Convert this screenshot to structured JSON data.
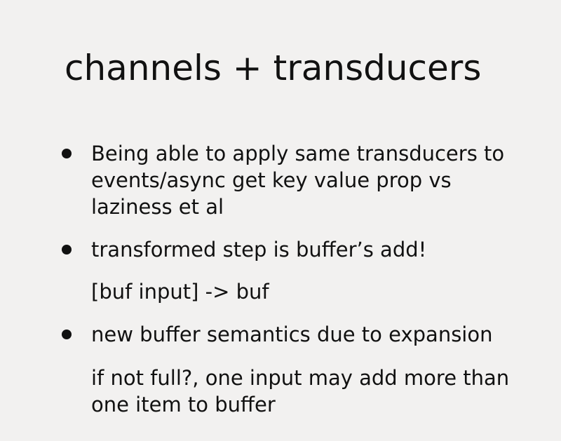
{
  "slide": {
    "title": "channels + transducers",
    "bullets": [
      {
        "text": "Being able to apply same transducers to events/async get key value prop vs laziness et al"
      },
      {
        "text": "transformed step is buffer’s add!",
        "subtext": "[buf input] -> buf"
      },
      {
        "text": "new buffer semantics due to expansion",
        "subtext": "if not full?, one input may add more than one item to buffer"
      }
    ]
  }
}
